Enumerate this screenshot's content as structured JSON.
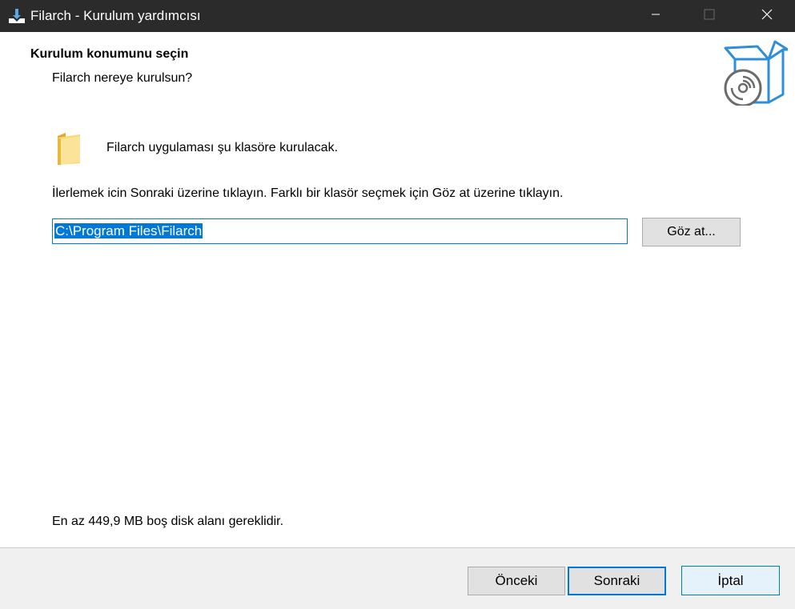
{
  "window": {
    "title": "Filarch - Kurulum yardımcısı"
  },
  "header": {
    "title": "Kurulum konumunu seçin",
    "subtitle": "Filarch nereye kurulsun?"
  },
  "main": {
    "folder_message": "Filarch uygulaması şu klasöre kurulacak.",
    "instruction": "İlerlemek icin Sonraki üzerine tıklayın. Farklı bir klasör seçmek için Göz at üzerine tıklayın.",
    "install_path": "C:\\Program Files\\Filarch",
    "browse_label": "Göz at...",
    "disk_space_note": "En az 449,9 MB boş disk alanı gereklidir."
  },
  "footer": {
    "back_label": "Önceki",
    "next_label": "Sonraki",
    "cancel_label": "İptal"
  },
  "icons": {
    "app": "installer-icon",
    "setup": "setup-box-disc-icon",
    "folder": "folder-icon",
    "minimize": "minimize-icon",
    "maximize": "maximize-icon",
    "close": "close-icon"
  },
  "colors": {
    "titlebar": "#2b2b2b",
    "accent": "#0078d7",
    "footer": "#f0f0f0",
    "button": "#e1e1e1"
  }
}
